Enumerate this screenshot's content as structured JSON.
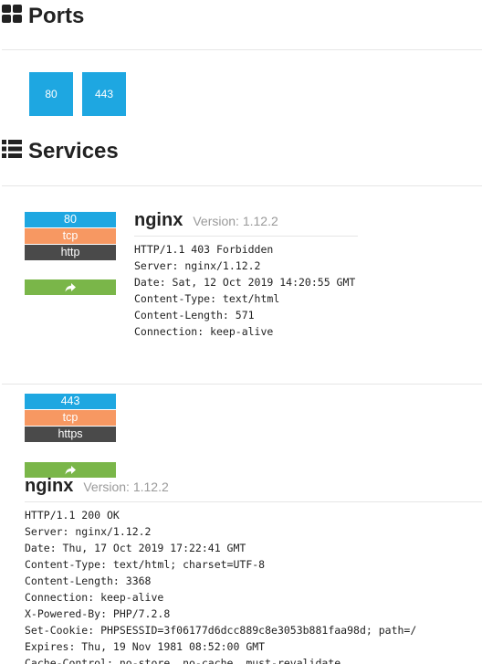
{
  "ports": {
    "title": "Ports",
    "list": [
      "80",
      "443"
    ]
  },
  "services": {
    "title": "Services",
    "items": [
      {
        "port": "80",
        "protocol": "tcp",
        "service": "http",
        "share_icon": "share-arrow-icon",
        "product": "nginx",
        "version_label": "Version: 1.12.2",
        "banner": [
          "HTTP/1.1 403 Forbidden",
          "Server: nginx/1.12.2",
          "Date: Sat, 12 Oct 2019 14:20:55 GMT",
          "Content-Type: text/html",
          "Content-Length: 571",
          "Connection: keep-alive"
        ]
      },
      {
        "port": "443",
        "protocol": "tcp",
        "service": "https",
        "share_icon": "share-arrow-icon",
        "product": "nginx",
        "version_label": "Version: 1.12.2",
        "banner": [
          "HTTP/1.1 200 OK",
          "Server: nginx/1.12.2",
          "Date: Thu, 17 Oct 2019 17:22:41 GMT",
          "Content-Type: text/html; charset=UTF-8",
          "Content-Length: 3368",
          "Connection: keep-alive",
          "X-Powered-By: PHP/7.2.8",
          "Set-Cookie: PHPSESSID=3f06177d6dcc889c8e3053b881faa98d; path=/",
          "Expires: Thu, 19 Nov 1981 08:52:00 GMT",
          "Cache-Control: no-store, no-cache, must-revalidate"
        ]
      }
    ]
  },
  "colors": {
    "port_blue": "#1ea7e1",
    "protocol_orange": "#f79862",
    "service_dark": "#4a4a4a",
    "share_green": "#7ab649"
  }
}
